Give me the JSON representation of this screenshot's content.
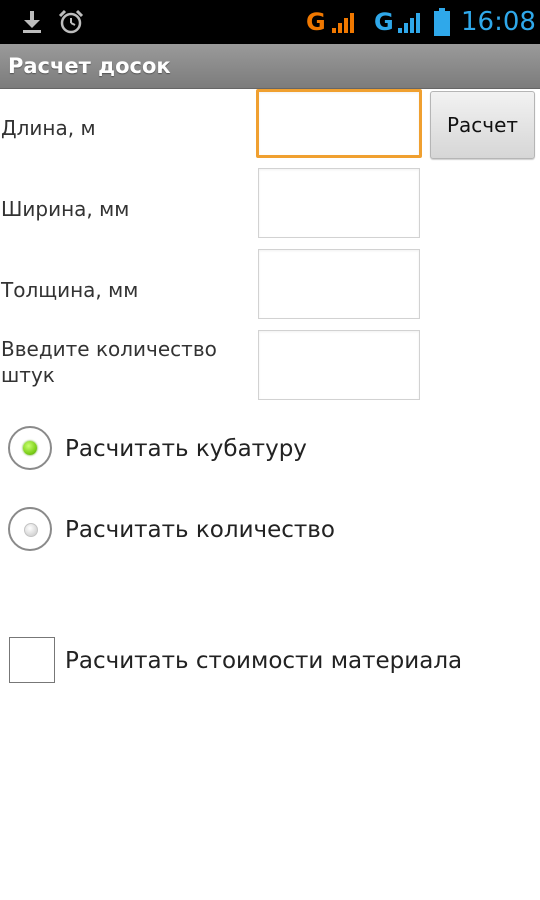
{
  "status_bar": {
    "time": "16:08",
    "network1": "G",
    "network2": "G",
    "network1_color": "#f07800",
    "network2_color": "#2fa8ea",
    "icons": [
      "download-icon",
      "alarm-icon",
      "signal-icon",
      "signal-icon",
      "battery-icon"
    ]
  },
  "header": {
    "title": "Расчет досок"
  },
  "form": {
    "length_label": "Длина, м",
    "width_label": "Ширина, мм",
    "thickness_label": "Толщина, мм",
    "quantity_label": "Введите количество штук",
    "calculate_button": "Расчет",
    "length_value": "",
    "width_value": "",
    "thickness_value": "",
    "quantity_value": ""
  },
  "options": {
    "volume_label": "Расчитать кубатуру",
    "volume_selected": true,
    "count_label": "Расчитать количество",
    "count_selected": false,
    "cost_label": "Расчитать стоимости материала",
    "cost_checked": false
  },
  "colors": {
    "focus_border": "#f0a030",
    "radio_selected": "#7fd11b",
    "title_bar": "#8a8a8a"
  }
}
